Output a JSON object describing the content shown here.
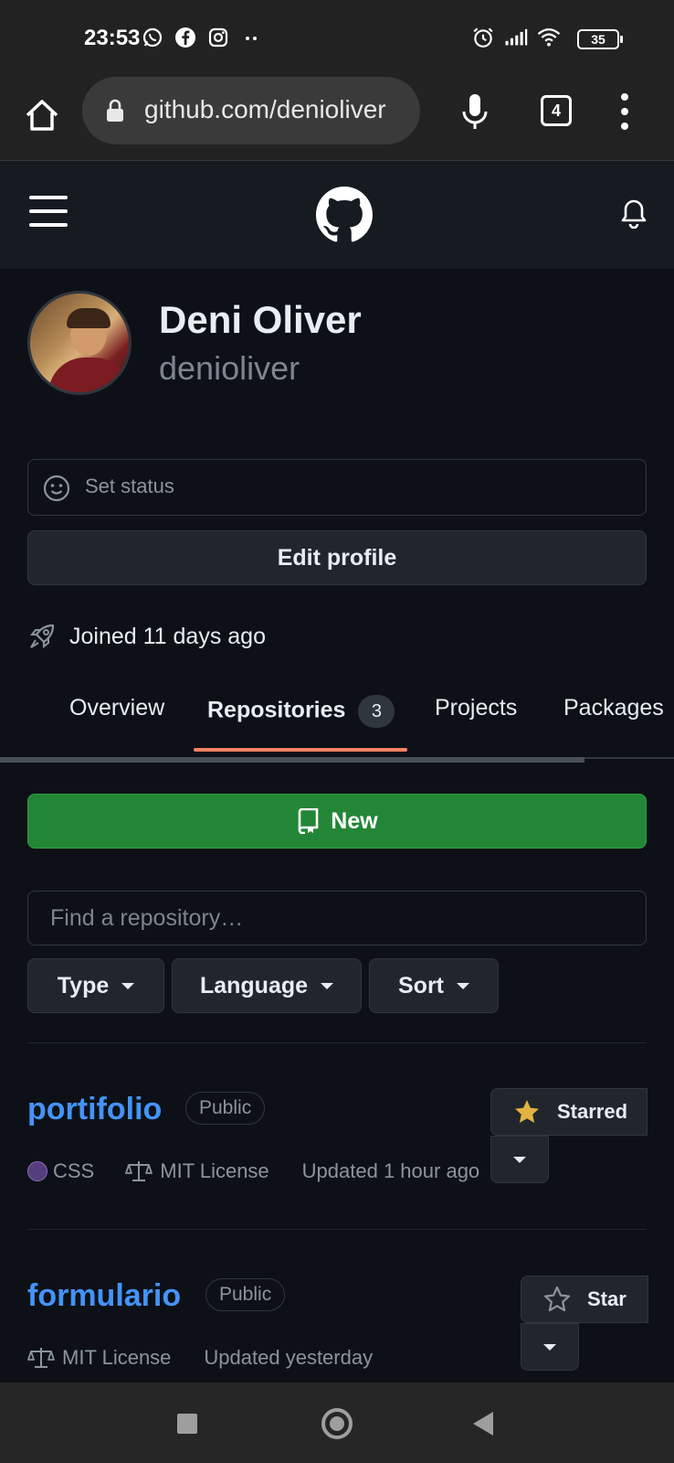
{
  "status_bar": {
    "time": "23:53",
    "left_icons": [
      "whatsapp-icon",
      "facebook-icon",
      "instagram-icon",
      "more-dots-icon"
    ],
    "right_icons": [
      "alarm-icon",
      "signal-icon",
      "wifi-icon"
    ],
    "battery": "35"
  },
  "browser": {
    "url": "github.com/denioliver",
    "tab_count": "4"
  },
  "profile": {
    "name": "Deni Oliver",
    "login": "denioliver",
    "set_status": "Set status",
    "edit_profile": "Edit profile",
    "joined": "Joined 11 days ago"
  },
  "tabs": [
    {
      "label": "Overview"
    },
    {
      "label": "Repositories",
      "count": "3",
      "active": true
    },
    {
      "label": "Projects"
    },
    {
      "label": "Packages"
    }
  ],
  "repo_actions": {
    "new_label": "New",
    "search_placeholder": "Find a repository…",
    "filters": [
      "Type",
      "Language",
      "Sort"
    ]
  },
  "repos": [
    {
      "name": "portifolio",
      "visibility": "Public",
      "language": "CSS",
      "language_color": "#563d7c",
      "license": "MIT License",
      "updated": "Updated 1 hour ago",
      "star_label": "Starred",
      "starred": true
    },
    {
      "name": "formulario",
      "visibility": "Public",
      "license": "MIT License",
      "updated": "Updated yesterday",
      "star_label": "Star",
      "starred": false
    }
  ],
  "colors": {
    "background": "#0d1117",
    "header": "#161b22",
    "link": "#4493f8",
    "primary_button": "#238636",
    "tab_underline": "#f78166",
    "star": "#e3b341"
  }
}
